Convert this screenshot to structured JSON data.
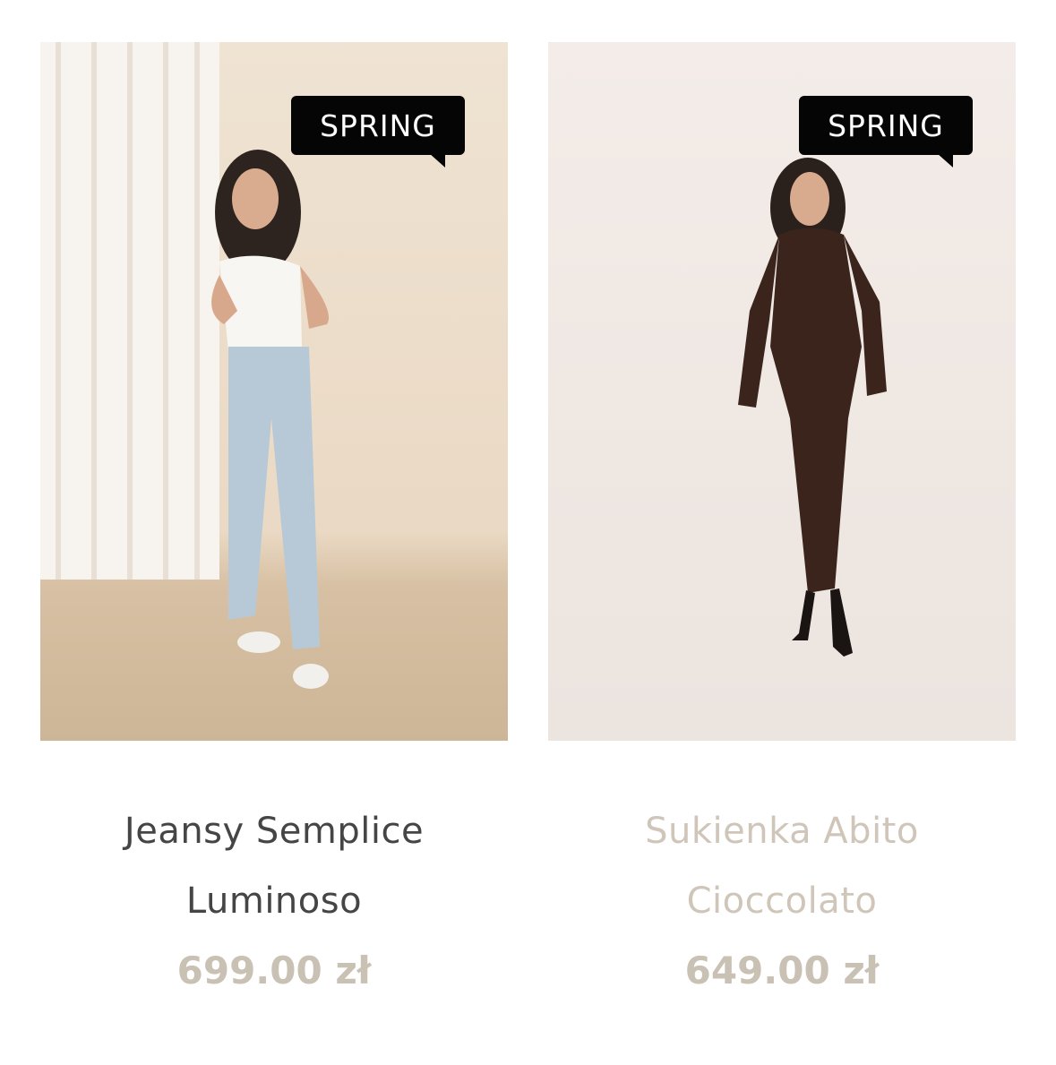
{
  "products": [
    {
      "badge": "SPRING",
      "title": "Jeansy Semplice Luminoso",
      "price": "699.00 zł",
      "photo_bg": "#ead9c4"
    },
    {
      "badge": "SPRING",
      "title": "Sukienka Abito Cioccolato",
      "price": "649.00 zł",
      "photo_bg": "#efe7e2"
    }
  ],
  "colors": {
    "badge_bg": "#050505",
    "title_primary": "#454545",
    "title_muted": "#cfc6b9",
    "price": "#c9c1b3"
  }
}
